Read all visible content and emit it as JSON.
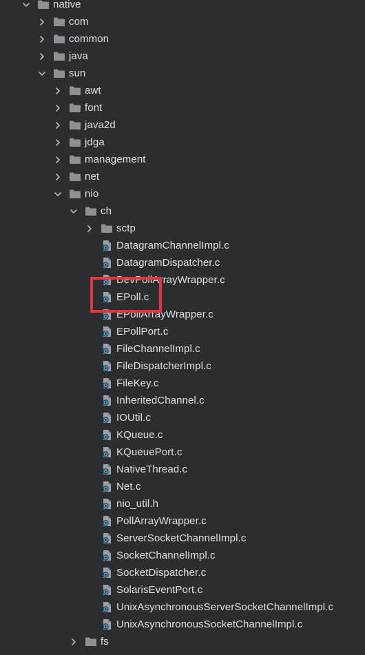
{
  "tree": [
    {
      "label": "native",
      "type": "folder",
      "expanded": true,
      "depth": 0
    },
    {
      "label": "com",
      "type": "folder",
      "expanded": false,
      "depth": 1
    },
    {
      "label": "common",
      "type": "folder",
      "expanded": false,
      "depth": 1
    },
    {
      "label": "java",
      "type": "folder",
      "expanded": false,
      "depth": 1
    },
    {
      "label": "sun",
      "type": "folder",
      "expanded": true,
      "depth": 1
    },
    {
      "label": "awt",
      "type": "folder",
      "expanded": false,
      "depth": 2
    },
    {
      "label": "font",
      "type": "folder",
      "expanded": false,
      "depth": 2
    },
    {
      "label": "java2d",
      "type": "folder",
      "expanded": false,
      "depth": 2
    },
    {
      "label": "jdga",
      "type": "folder",
      "expanded": false,
      "depth": 2
    },
    {
      "label": "management",
      "type": "folder",
      "expanded": false,
      "depth": 2
    },
    {
      "label": "net",
      "type": "folder",
      "expanded": false,
      "depth": 2
    },
    {
      "label": "nio",
      "type": "folder",
      "expanded": true,
      "depth": 2
    },
    {
      "label": "ch",
      "type": "folder",
      "expanded": true,
      "depth": 3
    },
    {
      "label": "sctp",
      "type": "folder",
      "expanded": false,
      "depth": 4
    },
    {
      "label": "DatagramChannelImpl.c",
      "type": "file",
      "depth": 4
    },
    {
      "label": "DatagramDispatcher.c",
      "type": "file",
      "depth": 4
    },
    {
      "label": "DevPollArrayWrapper.c",
      "type": "file",
      "depth": 4
    },
    {
      "label": "EPoll.c",
      "type": "file",
      "depth": 4,
      "highlighted": true
    },
    {
      "label": "EPollArrayWrapper.c",
      "type": "file",
      "depth": 4
    },
    {
      "label": "EPollPort.c",
      "type": "file",
      "depth": 4
    },
    {
      "label": "FileChannelImpl.c",
      "type": "file",
      "depth": 4
    },
    {
      "label": "FileDispatcherImpl.c",
      "type": "file",
      "depth": 4
    },
    {
      "label": "FileKey.c",
      "type": "file",
      "depth": 4
    },
    {
      "label": "InheritedChannel.c",
      "type": "file",
      "depth": 4
    },
    {
      "label": "IOUtil.c",
      "type": "file",
      "depth": 4
    },
    {
      "label": "KQueue.c",
      "type": "file",
      "depth": 4
    },
    {
      "label": "KQueuePort.c",
      "type": "file",
      "depth": 4
    },
    {
      "label": "NativeThread.c",
      "type": "file",
      "depth": 4
    },
    {
      "label": "Net.c",
      "type": "file",
      "depth": 4
    },
    {
      "label": "nio_util.h",
      "type": "file",
      "depth": 4
    },
    {
      "label": "PollArrayWrapper.c",
      "type": "file",
      "depth": 4
    },
    {
      "label": "ServerSocketChannelImpl.c",
      "type": "file",
      "depth": 4
    },
    {
      "label": "SocketChannelImpl.c",
      "type": "file",
      "depth": 4
    },
    {
      "label": "SocketDispatcher.c",
      "type": "file",
      "depth": 4
    },
    {
      "label": "SolarisEventPort.c",
      "type": "file",
      "depth": 4
    },
    {
      "label": "UnixAsynchronousServerSocketChannelImpl.c",
      "type": "file",
      "depth": 4
    },
    {
      "label": "UnixAsynchronousSocketChannelImpl.c",
      "type": "file",
      "depth": 4
    },
    {
      "label": "fs",
      "type": "folder",
      "expanded": false,
      "depth": 3
    }
  ],
  "colors": {
    "background": "#2b2d30",
    "text": "#dfe1e5",
    "folder": "#8c9196",
    "file": "#9aa0a6",
    "file_accent": "#3ea6e0",
    "arrow": "#b6b9bd",
    "highlight": "#e8353d"
  },
  "icons": {
    "folder": "folder-icon",
    "file": "c-file-icon",
    "expanded": "chevron-down-icon",
    "collapsed": "chevron-right-icon"
  }
}
